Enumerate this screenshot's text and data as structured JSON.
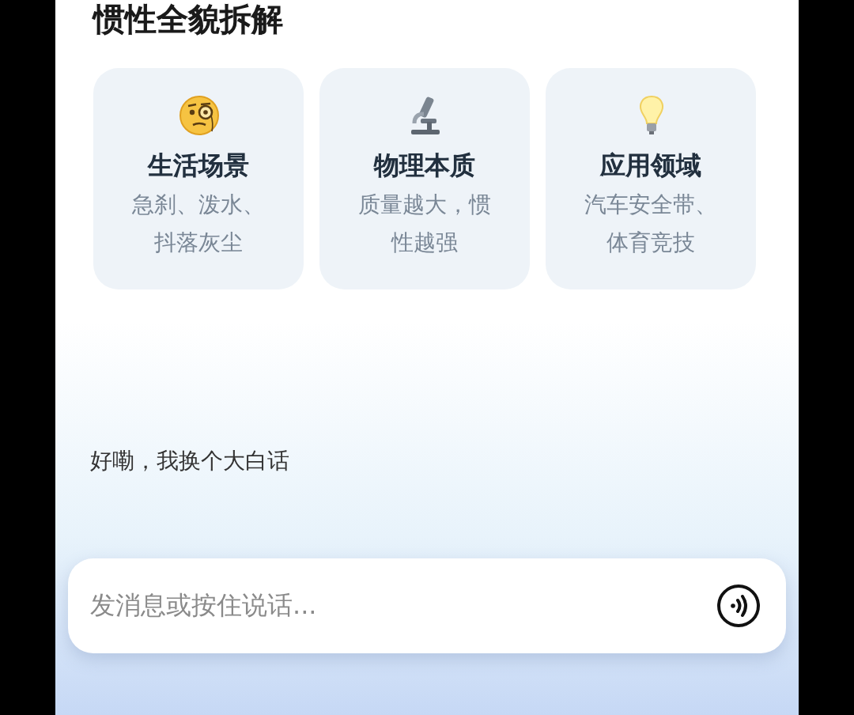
{
  "title": "惯性全貌拆解",
  "cards": [
    {
      "kind": "monocle",
      "heading": "生活场景",
      "text": "急刹、泼水、抖落灰尘"
    },
    {
      "kind": "microscope",
      "heading": "物理本质",
      "text": "质量越大，惯性越强"
    },
    {
      "kind": "bulb",
      "heading": "应用领域",
      "text": "汽车安全带、体育竞技"
    }
  ],
  "message": "好嘞，我换个大白话",
  "input": {
    "placeholder": "发消息或按住说话..."
  }
}
